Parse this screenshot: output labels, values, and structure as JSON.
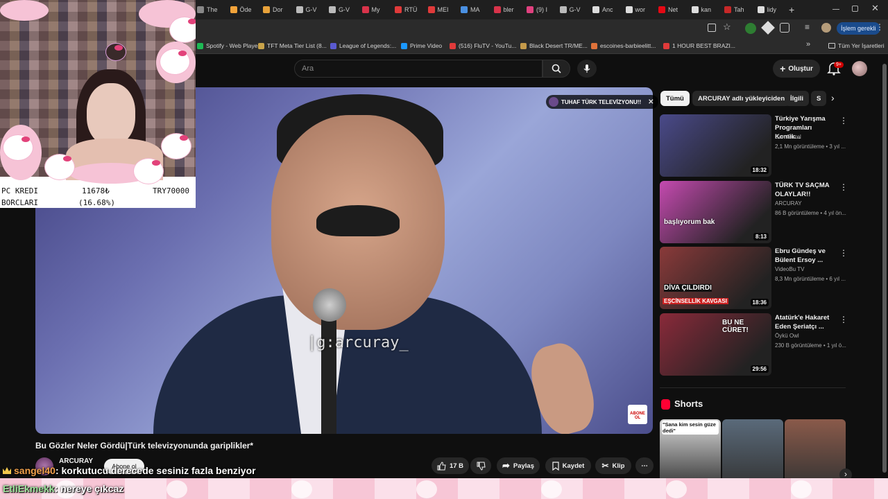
{
  "browser": {
    "tabs": [
      {
        "label": "The",
        "color": "#888888"
      },
      {
        "label": "Öde",
        "color": "#f2a33a"
      },
      {
        "label": "Dor",
        "color": "#e8a23a"
      },
      {
        "label": "G-V",
        "color": "#bbbbbb"
      },
      {
        "label": "G-V",
        "color": "#bbbbbb"
      },
      {
        "label": "My",
        "color": "#d8334a"
      },
      {
        "label": "RTÜ",
        "color": "#e03a3a"
      },
      {
        "label": "MEI",
        "color": "#e03a3a"
      },
      {
        "label": "MA",
        "color": "#4a90e2"
      },
      {
        "label": "bler",
        "color": "#d8334a"
      },
      {
        "label": "(9) I",
        "color": "#e0417f"
      },
      {
        "label": "G-V",
        "color": "#bbbbbb"
      },
      {
        "label": "Anc",
        "color": "#dddddd"
      },
      {
        "label": "wor",
        "color": "#dddddd"
      },
      {
        "label": "Net",
        "color": "#e50914"
      },
      {
        "label": "kan",
        "color": "#dddddd"
      },
      {
        "label": "Tah",
        "color": "#c62828"
      },
      {
        "label": "lidy",
        "color": "#dddddd"
      }
    ],
    "new_tab": "+",
    "action_label": "İşlem gerekli",
    "bookmarks": [
      {
        "label": "Spotify - Web Playe...",
        "color": "#1db954"
      },
      {
        "label": "TFT Meta Tier List (8...",
        "color": "#c9a34a"
      },
      {
        "label": "League of Legends:...",
        "color": "#5a5ad0"
      },
      {
        "label": "Prime Video",
        "color": "#1a98ff"
      },
      {
        "label": "(516) FluTV - YouTu...",
        "color": "#e03a3a"
      },
      {
        "label": "Black Desert TR/ME...",
        "color": "#c49a4a"
      },
      {
        "label": "escoines-barbieelitt...",
        "color": "#e0723a"
      },
      {
        "label": "1 HOUR BEST BRAZI...",
        "color": "#e03a3a"
      }
    ],
    "bookmarks_more": "»",
    "all_bookmarks": "Tüm Yer İşaretleri"
  },
  "youtube": {
    "search_placeholder": "Ara",
    "create_label": "Oluştur",
    "notif_count": "9+",
    "player": {
      "channel_chip": "TUHAF TÜRK TELEVİZYONU!!",
      "watermark": "|g:arcuray_",
      "subscribe_logo": "ABONE OL"
    },
    "video_title": "Bu Gözler Neler Gördü|Türk televizyonunda gariplikler*",
    "channel_name": "ARCURAY",
    "subscribe_label": "Abone ol",
    "actions": {
      "likes": "17 B",
      "share": "Paylaş",
      "save": "Kaydet",
      "clip": "Klip",
      "more": "⋯"
    },
    "chips": [
      "Tümü",
      "ARCURAY adlı yükleyiciden",
      "İlgili",
      "S"
    ],
    "recommendations": [
      {
        "title": "Türkiye Yarışma Programları Komik...",
        "channel": "Can Guzel",
        "meta": "2,1 Mn görüntüleme • 3 yıl ...",
        "duration": "18:32",
        "thumb_color": "#4a4a8a"
      },
      {
        "title": "TÜRK TV SAÇMA OLAYLAR!!",
        "channel": "ARCURAY",
        "meta": "86 B görüntüleme • 4 yıl ön...",
        "duration": "8:13",
        "thumb_color": "#c54ab0",
        "thumb_text": "başlıyorum bak"
      },
      {
        "title": "Ebru Gündeş ve Bülent Ersoy ...",
        "channel": "VideoBu TV",
        "meta": "8,3 Mn görüntüleme • 6 yıl ...",
        "duration": "18:36",
        "thumb_color": "#8a3a3a",
        "thumb_text": "DİVA ÇILDIRDI",
        "thumb_text2": "EŞCİNSELLİK KAVGASI"
      },
      {
        "title": "Atatürk'e Hakaret Eden Şeriatçı ...",
        "channel": "Öykü Owl",
        "meta": "230 B görüntüleme • 1 yıl ö...",
        "duration": "29:56",
        "thumb_color": "#8a2a3a",
        "thumb_text": "BU NE CÜRET!"
      }
    ],
    "shorts_title": "Shorts",
    "shorts": [
      {
        "caption": "\"Sana kim sesin güze dedi\"",
        "color": "#d9d9d9"
      },
      {
        "caption": "",
        "color": "#5a6a7a"
      },
      {
        "caption": "",
        "color": "#8a5a4a"
      },
      {
        "caption": "",
        "color": "#c8a89a"
      }
    ]
  },
  "stream_overlay": {
    "stats": [
      {
        "label": "PC KREDI",
        "value": "11678₺",
        "extra": "TRY70000"
      },
      {
        "label": "BORCLARI",
        "value": "(16.68%)",
        "extra": ""
      }
    ],
    "chat": [
      {
        "user": "sangel40",
        "message": ": korkutucu derecede sesiniz fazla benziyor"
      },
      {
        "user": "EtliEkmekk",
        "message": ": nereye çıkcaz"
      }
    ]
  }
}
